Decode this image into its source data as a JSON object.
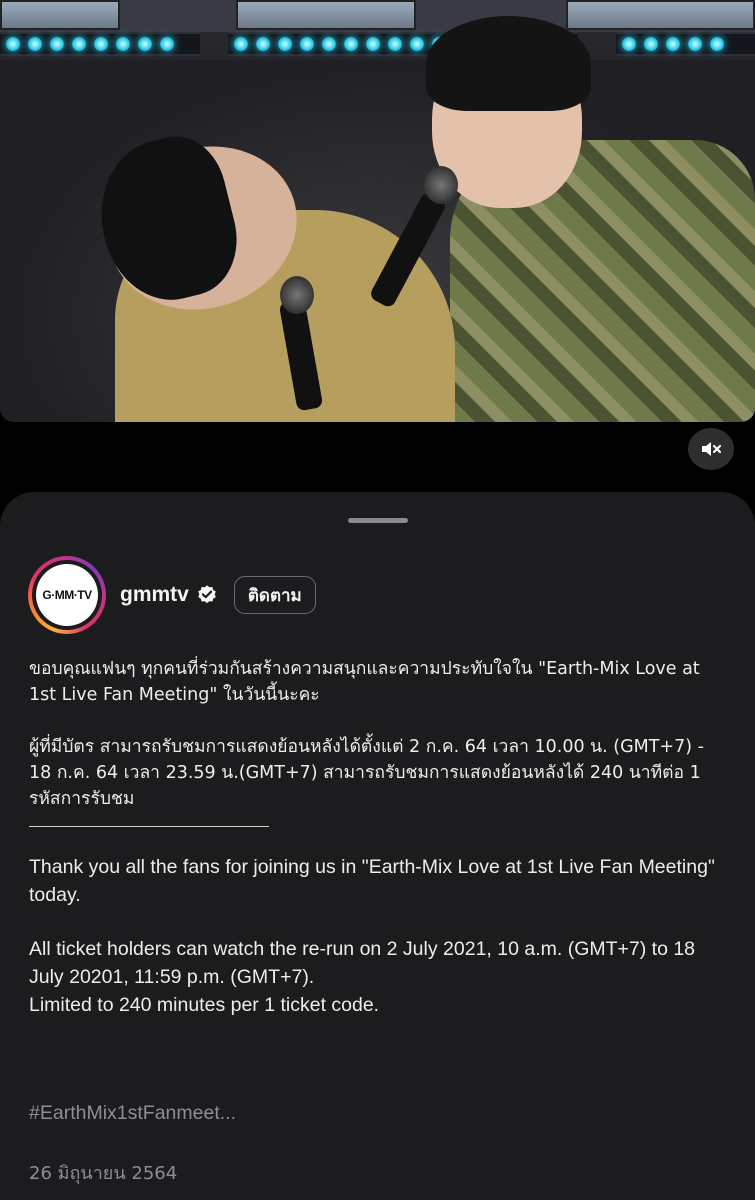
{
  "video": {
    "muted": true,
    "mute_icon": "speaker-muted-icon"
  },
  "sheet": {
    "account": {
      "avatar_text": "G·MM·TV",
      "username": "gmmtv",
      "verified": true,
      "verified_icon": "verified-badge-icon",
      "follow_label": "ติดตาม"
    },
    "caption": {
      "th_line1": "ขอบคุณแฟนๆ ทุกคนที่ร่วมกันสร้างความสนุกและความประทับใจใน \"Earth-Mix Love at 1st Live Fan Meeting\" ในวันนี้นะคะ",
      "th_line2": "ผู้ที่มีบัตร สามารถรับชมการแสดงย้อนหลังได้ตั้งแต่ 2 ก.ค. 64 เวลา 10.00 น. (GMT+7) - 18 ก.ค. 64 เวลา 23.59 น.(GMT+7) สามารถรับชมการแสดงย้อนหลังได้ 240 นาทีต่อ 1 รหัสการรับชม",
      "en_line1": "Thank you all the fans for joining us in \"Earth-Mix Love at 1st Live Fan Meeting\" today.",
      "en_line2a": "All ticket holders can watch the re-run on 2 July 2021, 10 a.m. (GMT+7) to 18 July 20201, 11:59 p.m. (GMT+7).",
      "en_line2b": "Limited to 240 minutes per 1 ticket code."
    },
    "hashtag": "#EarthMix1stFanmeet...",
    "date": "26 มิถุนายน 2564"
  }
}
